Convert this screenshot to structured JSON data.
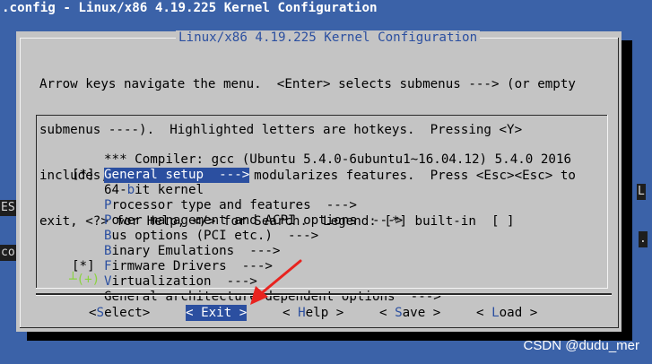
{
  "window": {
    "title": ".config - Linux/x86 4.19.225 Kernel Configuration"
  },
  "edge_tabs": {
    "left_1": "ES",
    "left_2": "co",
    "right_1": "L",
    "right_2": "."
  },
  "dialog": {
    "title": "Linux/x86 4.19.225 Kernel Configuration",
    "help_lines": [
      "Arrow keys navigate the menu.  <Enter> selects submenus ---> (or empty",
      "submenus ----).  Highlighted letters are hotkeys.  Pressing <Y>",
      "includes, <N> excludes, <M> modularizes features.  Press <Esc><Esc> to",
      "exit, <?> for Help, </> for Search.  Legend: [*] built-in  [ ]"
    ]
  },
  "menu": {
    "items": [
      {
        "mark": "",
        "hot": "",
        "rest": "*** Compiler: gcc (Ubuntu 5.4.0-6ubuntu1~16.04.12) 5.4.0 2016",
        "selected": false
      },
      {
        "mark": "",
        "hot": "G",
        "rest": "eneral setup  --->",
        "selected": true
      },
      {
        "mark": "[*]",
        "hot": "",
        "pre": "64-",
        "hot2": "b",
        "rest": "it kernel",
        "selected": false
      },
      {
        "mark": "",
        "hot": "P",
        "rest": "rocessor type and features  --->",
        "selected": false
      },
      {
        "mark": "",
        "hot": "P",
        "rest": "ower management and ACPI options  --->",
        "selected": false
      },
      {
        "mark": "",
        "hot": "B",
        "rest": "us options (PCI etc.)  --->",
        "selected": false
      },
      {
        "mark": "",
        "hot": "B",
        "rest": "inary Emulations  --->",
        "selected": false
      },
      {
        "mark": "",
        "hot": "F",
        "rest": "irmware Drivers  --->",
        "selected": false
      },
      {
        "mark": "[*]",
        "hot": "V",
        "rest": "irtualization  --->",
        "selected": false
      },
      {
        "mark": "",
        "hot": "",
        "rest": "General architecture-dependent options  --->",
        "selected": false
      }
    ],
    "more_indicator": "┴(+)"
  },
  "buttons": {
    "select": {
      "pre": "<",
      "hot": "S",
      "rest": "elect>"
    },
    "exit": {
      "pre": "< ",
      "hot": "E",
      "rest": "xit >"
    },
    "help": {
      "pre": "< ",
      "hot": "H",
      "rest": "elp >"
    },
    "save": {
      "pre": "< ",
      "hot": "S",
      "rest": "ave >"
    },
    "load": {
      "pre": "< ",
      "hot": "L",
      "rest": "oad >"
    }
  },
  "watermark": "CSDN @dudu_mer",
  "colors": {
    "background": "#3b62a8",
    "dialog": "#c4c4c4",
    "highlight": "#2b4fa0",
    "arrow": "#e8231f"
  }
}
